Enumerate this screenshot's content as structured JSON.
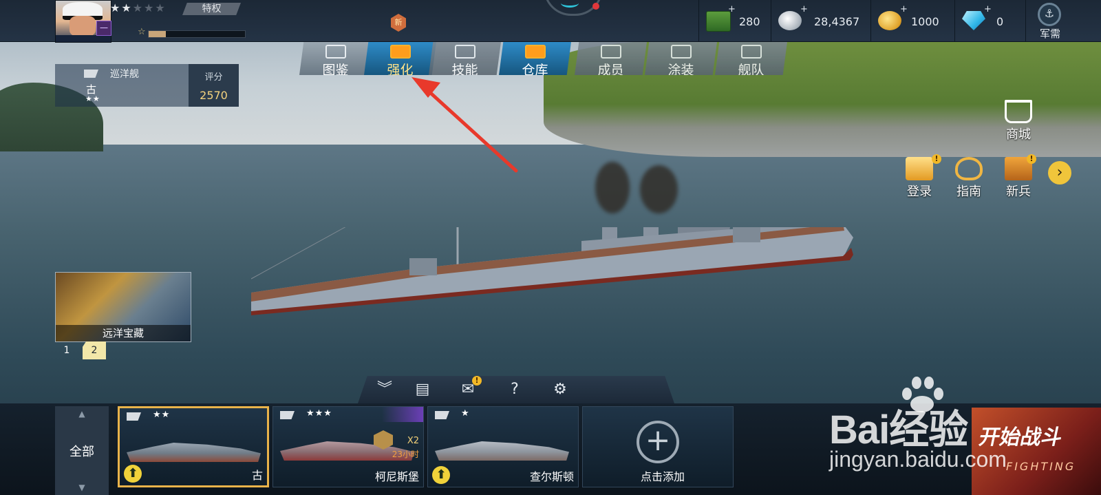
{
  "player": {
    "stars_filled": 2,
    "stars_total": 5,
    "privilege_label": "特权",
    "xp_progress": 0.18,
    "rank_badge": "一"
  },
  "event_medal_label": "新",
  "resources": [
    {
      "icon": "cash-icon",
      "plus": "+",
      "value": "280"
    },
    {
      "icon": "silver-coin-icon",
      "plus": "+",
      "value": "28,4367"
    },
    {
      "icon": "gold-coin-icon",
      "plus": "+",
      "value": "1000"
    },
    {
      "icon": "diamond-icon",
      "plus": "+",
      "value": "0"
    }
  ],
  "supply_label": "军需",
  "tabs": [
    {
      "label": "图鉴",
      "icon": "book-icon",
      "state": "normal"
    },
    {
      "label": "强化",
      "icon": "upgrade-icon",
      "state": "active"
    },
    {
      "label": "技能",
      "icon": "skill-icon",
      "state": "dim"
    },
    {
      "label": "仓库",
      "icon": "warehouse-icon",
      "state": "active"
    },
    {
      "label": "成员",
      "icon": "crew-icon",
      "state": "dim"
    },
    {
      "label": "涂装",
      "icon": "paint-icon",
      "state": "dim"
    },
    {
      "label": "舰队",
      "icon": "fleet-icon",
      "state": "dim"
    }
  ],
  "ship_card": {
    "type": "巡洋舰",
    "name": "古",
    "stars": "★★",
    "score_label": "评分",
    "score_value": "2570"
  },
  "side_buttons": {
    "shop": "商城",
    "login": "登录",
    "guide": "指南",
    "recruit": "新兵",
    "alert": "!"
  },
  "event": {
    "title": "远洋宝藏",
    "pages": [
      "1",
      "2"
    ],
    "current_page": "2"
  },
  "toolbar": {
    "icons": [
      "collapse-icon",
      "clipboard-icon",
      "mail-icon",
      "help-icon",
      "settings-icon"
    ],
    "help_glyph": "?",
    "mail_alert": "!"
  },
  "fleet": {
    "filter_label": "全部",
    "ships": [
      {
        "name": "古",
        "stars": "★★",
        "selected": true,
        "upgrade": true
      },
      {
        "name": "柯尼斯堡",
        "stars": "★★★",
        "selected": false,
        "upgrade": false,
        "bonus": "X2",
        "timer": "23小时"
      },
      {
        "name": "查尔斯顿",
        "stars": "★",
        "selected": false,
        "upgrade": true
      }
    ],
    "add_label": "点击添加"
  },
  "watermark": {
    "brand": "Bai经验",
    "url": "jingyan.baidu.com"
  },
  "fight_button": {
    "label": "开始战斗",
    "sub": "FIGHTING"
  },
  "colors": {
    "active_tab": "#2e8bc7",
    "score": "#f4d37e",
    "selected_card": "#e9b34a",
    "annotation_arrow": "#e8392b"
  }
}
